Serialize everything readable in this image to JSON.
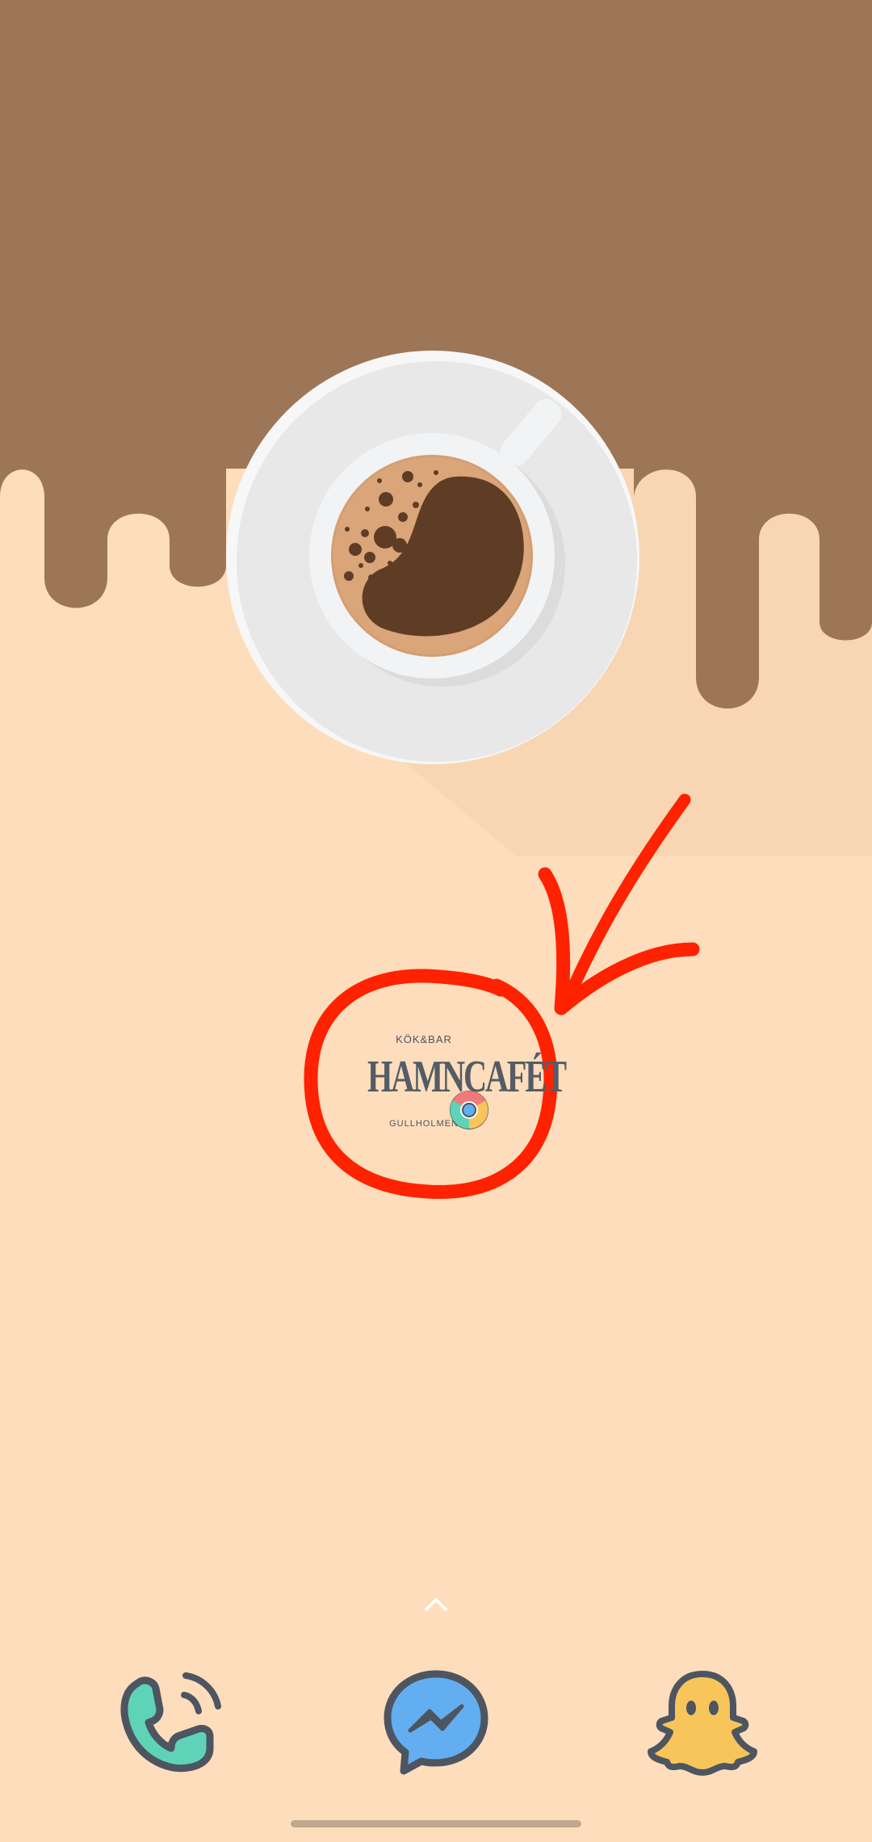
{
  "wallpaper": {
    "top_color": "#9c7657",
    "bottom_color": "#fdddbb",
    "saucer_color": "#e8e8e8",
    "cup_color": "#f2f3f4",
    "coffee_color": "#5f3d25",
    "crema_color": "#d49e72",
    "annotation_color": "#ff2200"
  },
  "app_shortcut": {
    "line_top": "KÖK&BAR",
    "line_main": "HAMNCAFÉT",
    "line_bottom": "GULLHOLMEN",
    "badge_icon": "chrome-icon"
  },
  "swipe_up": {
    "icon": "chevron-up-icon"
  },
  "dock": {
    "apps": [
      {
        "name": "Phone",
        "icon": "phone-icon",
        "color": "#5fd3b8"
      },
      {
        "name": "Messenger",
        "icon": "messenger-icon",
        "color": "#62aef0"
      },
      {
        "name": "Snapchat",
        "icon": "snapchat-ghost-icon",
        "color": "#f8c55a"
      }
    ]
  }
}
